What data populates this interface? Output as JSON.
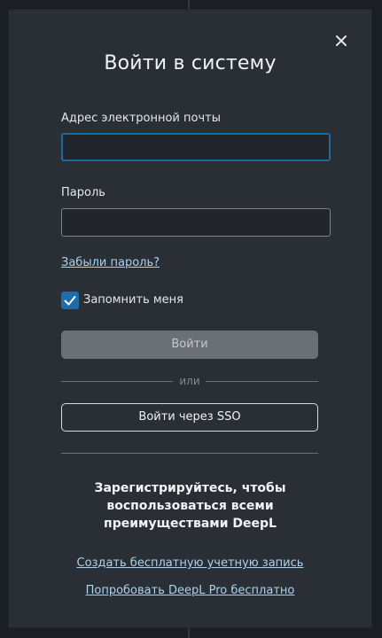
{
  "dialog": {
    "title": "Войти в систему",
    "close_icon": "close-icon"
  },
  "form": {
    "email_label": "Адрес электронной почты",
    "email_value": "",
    "password_label": "Пароль",
    "password_value": "",
    "forgot_password": "Забыли пароль?",
    "remember_label": "Запомнить меня",
    "remember_checked": true,
    "login_button": "Войти",
    "or_text": "или",
    "sso_button": "Войти через SSO"
  },
  "promo": {
    "lines": [
      "Зарегистрируйтесь, чтобы",
      "воспользоваться всеми",
      "преимуществами DeepL"
    ],
    "create_account_link": "Создать бесплатную учетную запись",
    "try_pro_link": "Попробовать DeepL Pro бесплатно"
  },
  "colors": {
    "background": "#1b1e23",
    "dialog": "#2a2e35",
    "accent": "#1d6ea8",
    "link": "#a9d3ee",
    "disabled_button": "#6b6f76"
  }
}
